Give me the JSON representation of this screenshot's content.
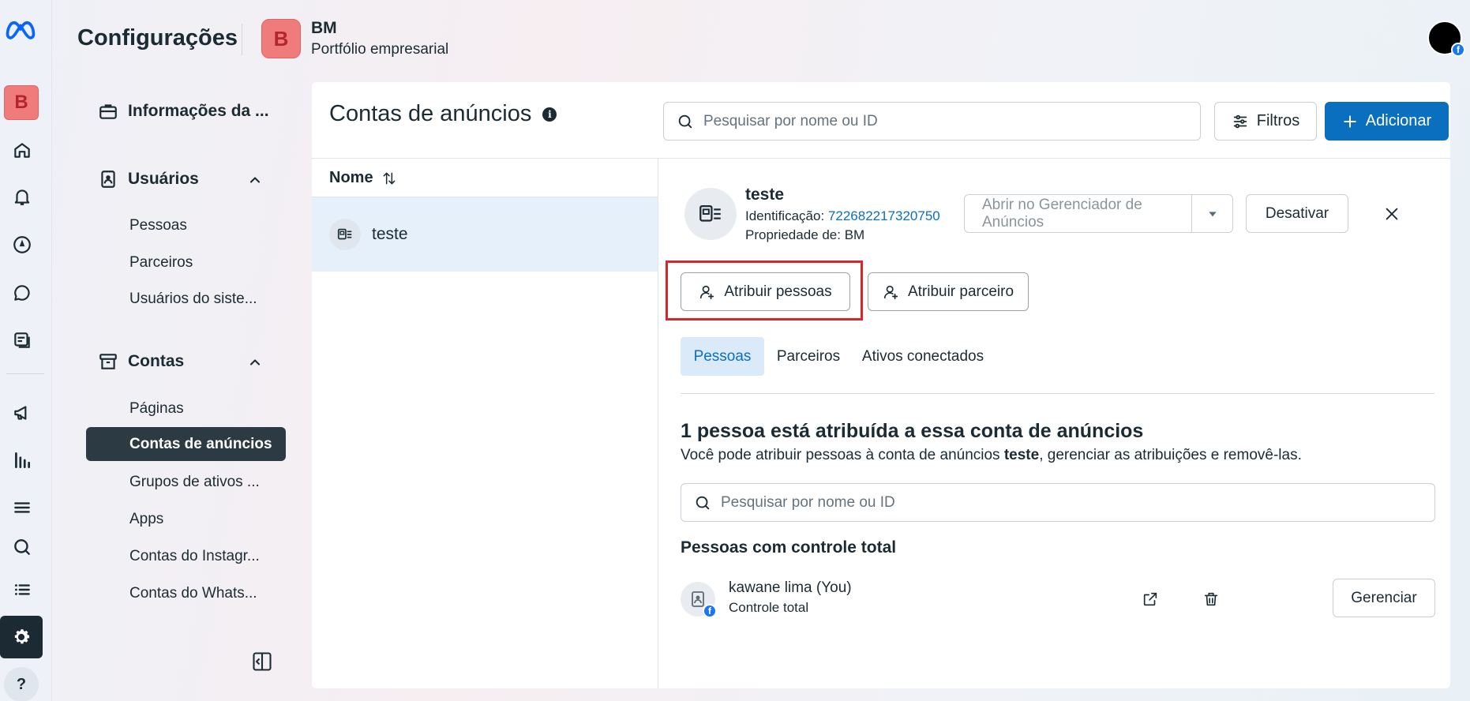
{
  "app": {
    "title": "Configurações",
    "business_initial": "B",
    "business_name": "BM",
    "business_subtitle": "Portfólio empresarial"
  },
  "rail": {
    "business_initial": "B",
    "help_label": "?",
    "items": [
      "home-icon",
      "bell-icon",
      "compass-icon",
      "chat-icon",
      "pages-icon",
      "megaphone-icon",
      "chart-icon",
      "menu-icon",
      "search-icon",
      "list-icon",
      "gear-icon"
    ]
  },
  "nav": {
    "business_info": "Informações da ...",
    "users_section": "Usuários",
    "users_items": [
      "Pessoas",
      "Parceiros",
      "Usuários do siste..."
    ],
    "accounts_section": "Contas",
    "accounts_items": [
      "Páginas",
      "Contas de anúncios",
      "Grupos de ativos ...",
      "Apps",
      "Contas do Instagr...",
      "Contas do Whats..."
    ],
    "active_item": "Contas de anúncios"
  },
  "panel": {
    "title": "Contas de anúncios",
    "search_placeholder": "Pesquisar por nome ou ID",
    "filters_label": "Filtros",
    "add_label": "Adicionar",
    "column_name": "Nome",
    "list": [
      {
        "name": "teste"
      }
    ]
  },
  "detail": {
    "name": "teste",
    "id_label": "Identificação:",
    "id_value": "722682217320750",
    "owner_label": "Propriedade de: BM",
    "open_manager_label": "Abrir no Gerenciador de Anúncios",
    "deactivate_label": "Desativar",
    "assign_people_label": "Atribuir pessoas",
    "assign_partner_label": "Atribuir parceiro",
    "tabs": [
      "Pessoas",
      "Parceiros",
      "Ativos conectados"
    ],
    "active_tab": "Pessoas",
    "assigned_heading": "1 pessoa está atribuída a essa conta de anúncios",
    "assigned_desc_prefix": "Você pode atribuir pessoas à conta de anúncios ",
    "assigned_desc_bold": "teste",
    "assigned_desc_suffix": ", gerenciar as atribuições e removê-las.",
    "people_search_placeholder": "Pesquisar por nome ou ID",
    "full_control_heading": "Pessoas com controle total",
    "people": [
      {
        "name": "kawane lima (You)",
        "role": "Controle total",
        "manage_label": "Gerenciar"
      }
    ]
  },
  "colors": {
    "primary": "#0a6fbf",
    "dark_nav": "#2b3a43",
    "business_avatar": "#f07b7b",
    "highlight": "#d9262b"
  }
}
